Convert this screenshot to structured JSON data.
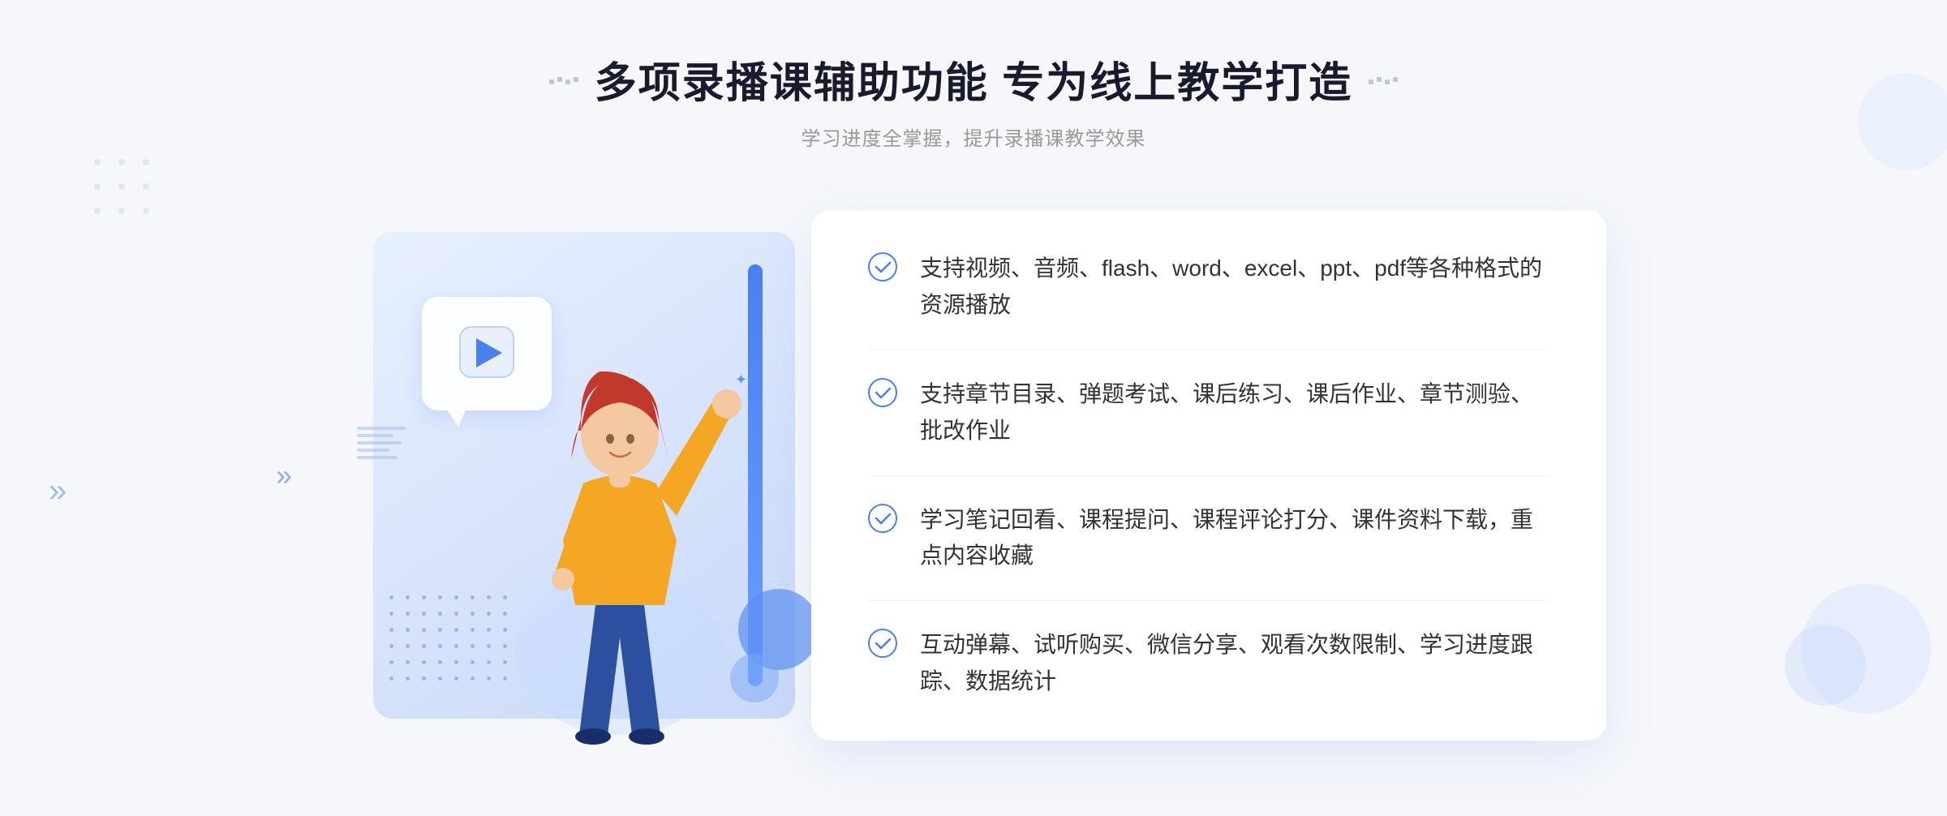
{
  "header": {
    "title": "多项录播课辅助功能 专为线上教学打造",
    "subtitle": "学习进度全掌握，提升录播课教学效果",
    "decorator_left": "❖",
    "decorator_right": "❖"
  },
  "features": [
    {
      "id": 1,
      "text": "支持视频、音频、flash、word、excel、ppt、pdf等各种格式的资源播放"
    },
    {
      "id": 2,
      "text": "支持章节目录、弹题考试、课后练习、课后作业、章节测验、批改作业"
    },
    {
      "id": 3,
      "text": "学习笔记回看、课程提问、课程评论打分、课件资料下载，重点内容收藏"
    },
    {
      "id": 4,
      "text": "互动弹幕、试听购买、微信分享、观看次数限制、学习进度跟踪、数据统计"
    }
  ],
  "colors": {
    "primary": "#4a7ff0",
    "title": "#1a1a2e",
    "subtitle": "#999999",
    "text": "#333333",
    "check": "#4a7ff0",
    "bg": "#f5f7fb",
    "panel_bg": "#ffffff"
  },
  "arrows_left": "»",
  "play_label": "播放"
}
